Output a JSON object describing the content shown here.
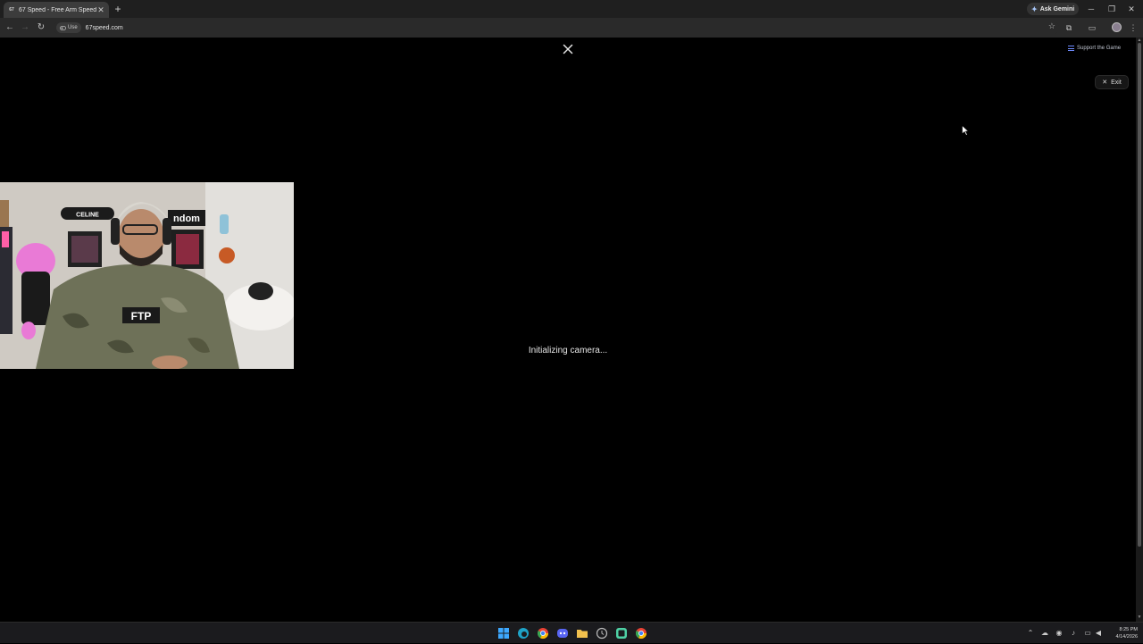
{
  "browser": {
    "tab": {
      "favicon_text": "67",
      "title": "67 Speed - Free Arm Speed Ch..."
    },
    "ask_gemini_label": "Ask Gemini",
    "site_chip_label": "Use",
    "url": "67speed.com"
  },
  "page": {
    "support_label": "Support the Game",
    "exit_label": "Exit",
    "status_text": "Initializing camera...",
    "webcam": {
      "shirt_text": "FTP",
      "sign_left": "CELINE",
      "sign_right": "ndom"
    }
  },
  "taskbar": {
    "time": "8:25 PM",
    "date": "4/14/2026"
  },
  "colors": {
    "page_bg": "#000000",
    "accent": "#6e8bff"
  }
}
